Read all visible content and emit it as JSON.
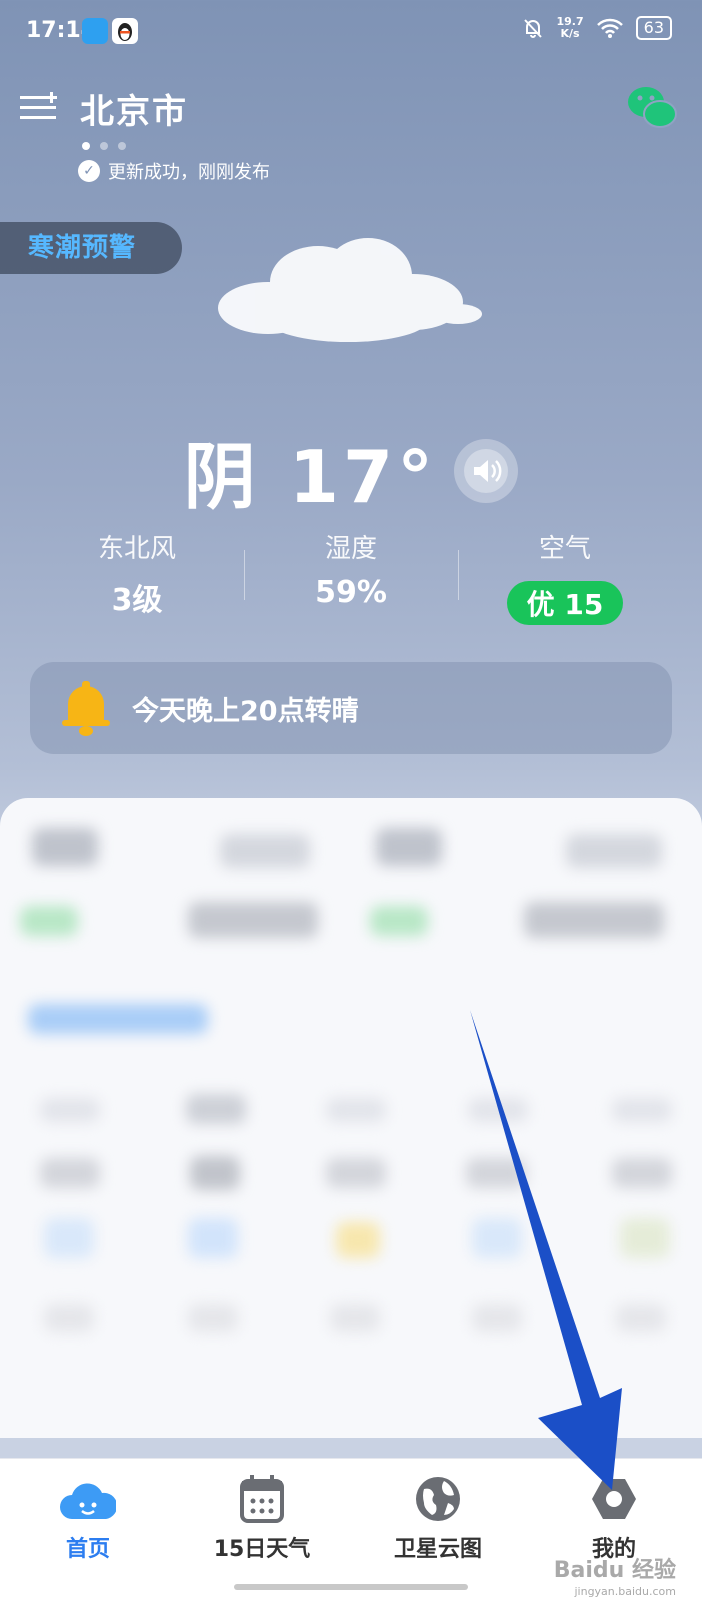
{
  "status_bar": {
    "time": "17:14",
    "net_speed_value": "19.7",
    "net_speed_unit": "K/s",
    "battery": "63"
  },
  "header": {
    "city": "北京市",
    "update_text": "更新成功，刚刚发布",
    "alert": "寒潮预警"
  },
  "current": {
    "condition": "阴",
    "temperature": "17°"
  },
  "metrics": [
    {
      "label": "东北风",
      "value": "3级"
    },
    {
      "label": "湿度",
      "value": "59%"
    },
    {
      "label": "空气",
      "value": "优 15"
    }
  ],
  "notice": "今天晚上20点转晴",
  "nav": [
    {
      "label": "首页",
      "icon": "cloud-face-icon"
    },
    {
      "label": "15日天气",
      "icon": "calendar-icon"
    },
    {
      "label": "卫星云图",
      "icon": "globe-icon"
    },
    {
      "label": "我的",
      "icon": "settings-hex-icon"
    }
  ],
  "watermark": {
    "main": "Baidu 经验",
    "sub": "jingyan.baidu.com"
  },
  "colors": {
    "accent_blue": "#2c7df0",
    "alert_blue": "#56b8ff",
    "aqi_green": "#19c45a",
    "annotation_arrow": "#1b4fc7"
  }
}
